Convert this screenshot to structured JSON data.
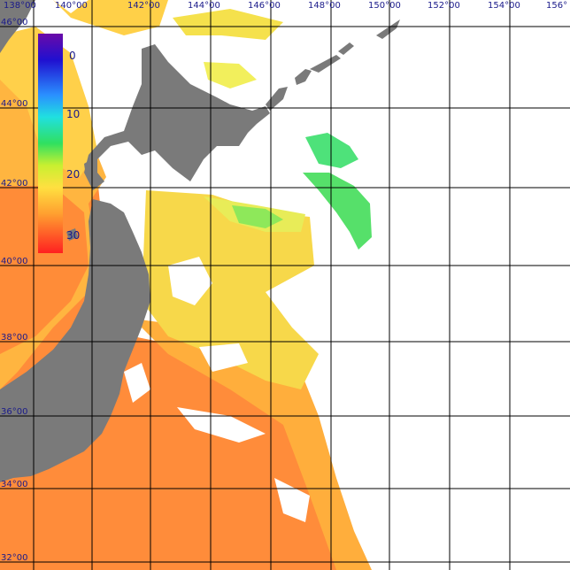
{
  "map": {
    "longitude_labels": [
      "138°00",
      "140°00",
      "142°00",
      "144°00",
      "146°00",
      "148°00",
      "150°00",
      "152°00",
      "154°00",
      "156°"
    ],
    "latitude_labels": [
      "46°00",
      "44°00",
      "42°00",
      "40°00",
      "38°00",
      "36°00",
      "34°00",
      "32°00"
    ],
    "colors": {
      "land": "#7a7a7a",
      "grid": "#000000",
      "label": "#1a1a8a",
      "no_data": "#ffffff"
    }
  },
  "legend": {
    "ticks": [
      "0",
      "10",
      "20",
      "30"
    ],
    "colors": [
      "#5a0aa0",
      "#1020e0",
      "#2aa0ff",
      "#20e0e0",
      "#30e060",
      "#c0f030",
      "#ffe040",
      "#ffb030",
      "#ff7030",
      "#ff2020"
    ]
  }
}
